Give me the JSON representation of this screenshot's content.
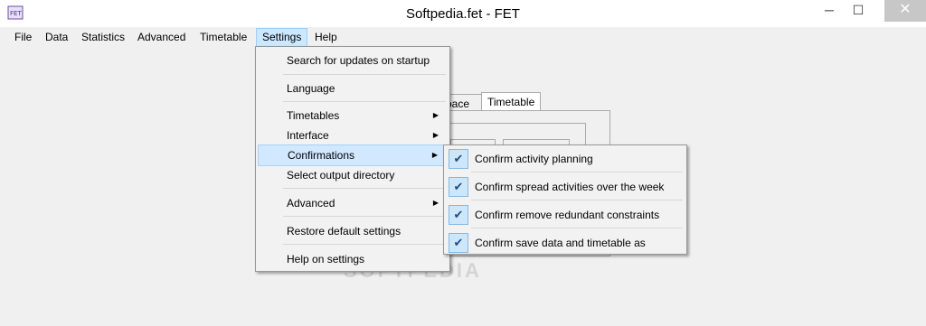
{
  "window": {
    "title": "Softpedia.fet - FET",
    "minimize_glyph": "─",
    "maximize_glyph": "☐",
    "close_glyph": "✕",
    "app_icon": "fet-logo-icon"
  },
  "menubar": {
    "items": [
      {
        "label": "File"
      },
      {
        "label": "Data"
      },
      {
        "label": "Statistics"
      },
      {
        "label": "Advanced"
      },
      {
        "label": "Timetable"
      },
      {
        "label": "Settings"
      },
      {
        "label": "Help"
      }
    ]
  },
  "tabs": {
    "partial": "pace",
    "selected": "Timetable"
  },
  "settings_menu": {
    "items": [
      {
        "label": "Search for updates on startup"
      },
      {
        "label": "Language"
      },
      {
        "label": "Timetables"
      },
      {
        "label": "Interface"
      },
      {
        "label": "Confirmations"
      },
      {
        "label": "Select output directory"
      },
      {
        "label": "Advanced"
      },
      {
        "label": "Restore default settings"
      },
      {
        "label": "Help on settings"
      }
    ]
  },
  "confirmations_submenu": {
    "items": [
      {
        "label": "Confirm activity planning",
        "checked": true
      },
      {
        "label": "Confirm spread activities over the week",
        "checked": true
      },
      {
        "label": "Confirm remove redundant constraints",
        "checked": true
      },
      {
        "label": "Confirm save data and timetable as",
        "checked": true
      }
    ],
    "check_glyph": "✔"
  },
  "watermark": "SOFTPEDIA",
  "colors": {
    "highlight": "#cce8ff",
    "close_button": "#c7c7c7"
  }
}
